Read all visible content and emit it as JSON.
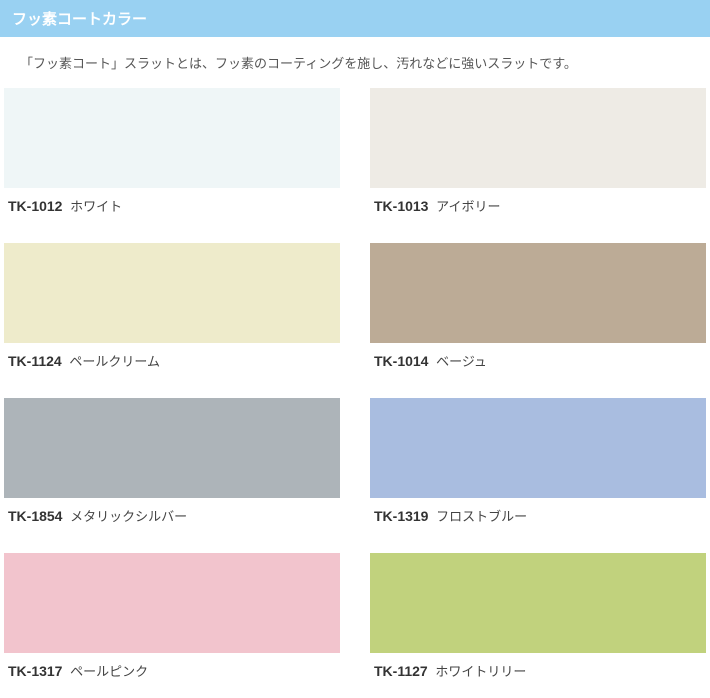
{
  "header": {
    "title": "フッ素コートカラー"
  },
  "description": "「フッ素コート」スラットとは、フッ素のコーティングを施し、汚れなどに強いスラットです。",
  "swatches": [
    {
      "code": "TK-1012",
      "name": "ホワイト",
      "color": "#eff6f7"
    },
    {
      "code": "TK-1013",
      "name": "アイボリー",
      "color": "#eeebe5"
    },
    {
      "code": "TK-1124",
      "name": "ペールクリーム",
      "color": "#eeebcb"
    },
    {
      "code": "TK-1014",
      "name": "ベージュ",
      "color": "#bcab96"
    },
    {
      "code": "TK-1854",
      "name": "メタリックシルバー",
      "color": "#adb4b9"
    },
    {
      "code": "TK-1319",
      "name": "フロストブルー",
      "color": "#a9bde0"
    },
    {
      "code": "TK-1317",
      "name": "ペールピンク",
      "color": "#f2c4cd"
    },
    {
      "code": "TK-1127",
      "name": "ホワイトリリー",
      "color": "#c1d27d"
    }
  ]
}
